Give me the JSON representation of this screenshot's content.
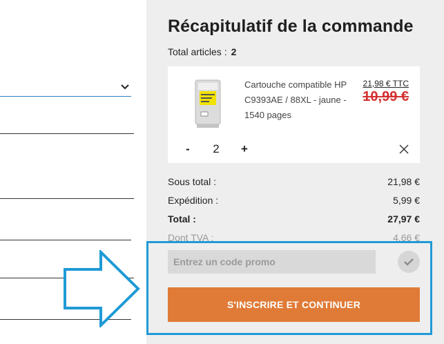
{
  "summary": {
    "title": "Récapitulatif de la commande",
    "total_articles_label": "Total articles :",
    "total_articles_count": "2"
  },
  "cart_item": {
    "name": "Cartouche compatible HP C9393AE / 88XL - jaune - 1540 pages",
    "old_price": "21,98 € TTC",
    "new_price": "10,99 €",
    "qty_minus": "-",
    "quantity": "2",
    "qty_plus": "+",
    "remove_icon": "close-icon",
    "image_icon": "ink-cartridge-icon"
  },
  "totals": [
    {
      "label": "Sous total :",
      "value": "21,98 €"
    },
    {
      "label": "Expédition :",
      "value": "5,99 €"
    },
    {
      "label": "Total :",
      "value": "27,97 €"
    },
    {
      "label": "Dont TVA :",
      "value": "4,66 €"
    }
  ],
  "promo": {
    "placeholder": "Entrez un code promo",
    "check_icon": "checkmark-icon"
  },
  "cta": {
    "label": "S'INSCRIRE ET CONTINUER"
  },
  "left_form": {
    "select_icon": "chevron-down-icon"
  },
  "annotation": {
    "arrow_icon": "right-arrow-icon",
    "highlight_color": "#1f9ad6"
  },
  "colors": {
    "accent": "#e07b37",
    "price_red": "#d32f2f",
    "panel_bg": "#eeeeee"
  }
}
